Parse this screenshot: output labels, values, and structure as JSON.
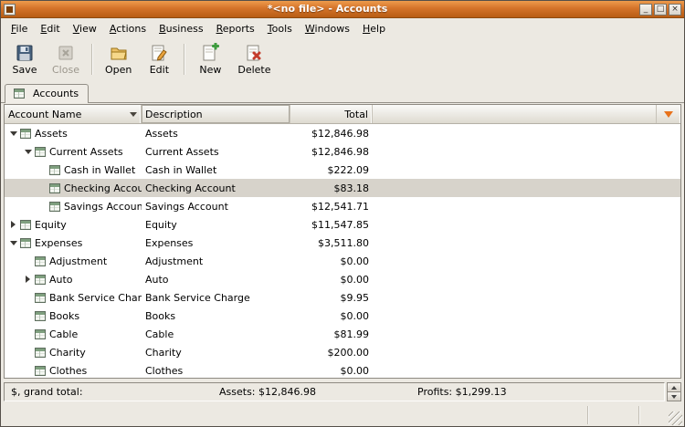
{
  "window": {
    "title": "*<no file> - Accounts",
    "controls": {
      "minimize": "_",
      "maximize": "□",
      "close": "×"
    }
  },
  "menu": {
    "items": [
      "File",
      "Edit",
      "View",
      "Actions",
      "Business",
      "Reports",
      "Tools",
      "Windows",
      "Help"
    ]
  },
  "toolbar": {
    "save": "Save",
    "close": "Close",
    "open": "Open",
    "edit": "Edit",
    "new": "New",
    "delete": "Delete"
  },
  "tab": {
    "label": "Accounts"
  },
  "table": {
    "headers": {
      "name": "Account Name",
      "description": "Description",
      "total": "Total"
    },
    "rows": [
      {
        "name": "Assets",
        "description": "Assets",
        "total": "$12,846.98",
        "level": 0,
        "expander": "open",
        "selected": false
      },
      {
        "name": "Current Assets",
        "description": "Current Assets",
        "total": "$12,846.98",
        "level": 1,
        "expander": "open",
        "selected": false
      },
      {
        "name": "Cash in Wallet",
        "description": "Cash in Wallet",
        "total": "$222.09",
        "level": 2,
        "expander": "none",
        "selected": false
      },
      {
        "name": "Checking Account",
        "description": "Checking Account",
        "total": "$83.18",
        "level": 2,
        "expander": "none",
        "selected": true
      },
      {
        "name": "Savings Account",
        "description": "Savings Account",
        "total": "$12,541.71",
        "level": 2,
        "expander": "none",
        "selected": false
      },
      {
        "name": "Equity",
        "description": "Equity",
        "total": "$11,547.85",
        "level": 0,
        "expander": "closed",
        "selected": false
      },
      {
        "name": "Expenses",
        "description": "Expenses",
        "total": "$3,511.80",
        "level": 0,
        "expander": "open",
        "selected": false
      },
      {
        "name": "Adjustment",
        "description": "Adjustment",
        "total": "$0.00",
        "level": 1,
        "expander": "none",
        "selected": false
      },
      {
        "name": "Auto",
        "description": "Auto",
        "total": "$0.00",
        "level": 1,
        "expander": "closed",
        "selected": false
      },
      {
        "name": "Bank Service Charge",
        "description": "Bank Service Charge",
        "total": "$9.95",
        "level": 1,
        "expander": "none",
        "selected": false
      },
      {
        "name": "Books",
        "description": "Books",
        "total": "$0.00",
        "level": 1,
        "expander": "none",
        "selected": false
      },
      {
        "name": "Cable",
        "description": "Cable",
        "total": "$81.99",
        "level": 1,
        "expander": "none",
        "selected": false
      },
      {
        "name": "Charity",
        "description": "Charity",
        "total": "$200.00",
        "level": 1,
        "expander": "none",
        "selected": false
      },
      {
        "name": "Clothes",
        "description": "Clothes",
        "total": "$0.00",
        "level": 1,
        "expander": "none",
        "selected": false
      }
    ]
  },
  "statusbar": {
    "grand_total_label": "$, grand total:",
    "assets": "Assets: $12,846.98",
    "profits": "Profits: $1,299.13"
  },
  "colors": {
    "titlebar_orange": "#d4732a",
    "header_arrow_orange": "#e8731c",
    "selection_gray": "#d7d3cb"
  }
}
